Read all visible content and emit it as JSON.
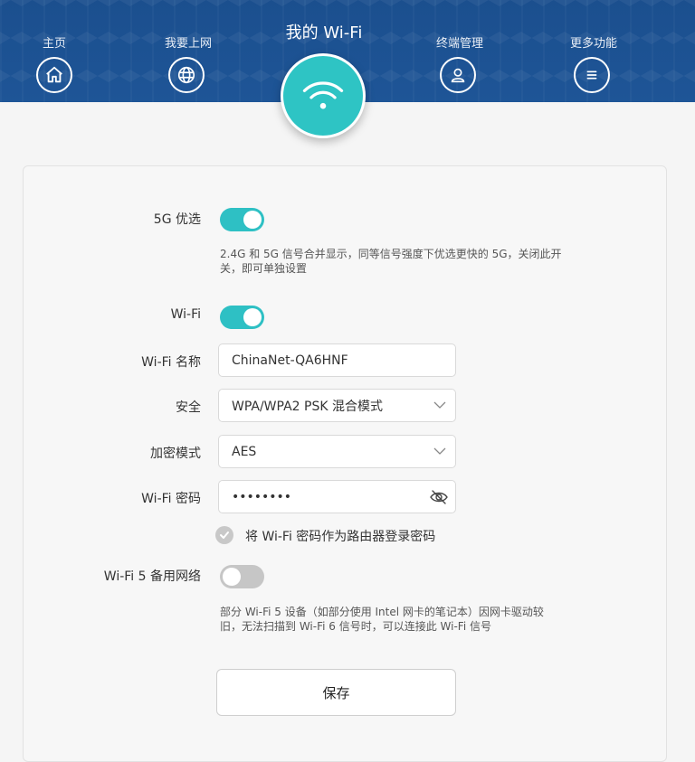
{
  "nav": {
    "items": [
      {
        "label": "主页",
        "icon": "home-icon"
      },
      {
        "label": "我要上网",
        "icon": "globe-icon"
      },
      {
        "label": "终端管理",
        "icon": "user-icon"
      },
      {
        "label": "更多功能",
        "icon": "menu-icon"
      }
    ],
    "active": {
      "label": "我的 Wi-Fi",
      "icon": "wifi-icon"
    }
  },
  "colors": {
    "header": "#1e5597",
    "accent": "#2ec0c4",
    "toggle_off": "#c6c6c6"
  },
  "settings": {
    "band_pref": {
      "label": "5G 优选",
      "state": "on",
      "hint": "2.4G 和 5G 信号合并显示，同等信号强度下优选更快的 5G，关闭此开关，即可单独设置"
    },
    "wifi": {
      "label": "Wi-Fi",
      "state": "on"
    },
    "ssid": {
      "label": "Wi-Fi 名称",
      "value": "ChinaNet-QA6HNF"
    },
    "security": {
      "label": "安全",
      "value": "WPA/WPA2 PSK 混合模式"
    },
    "encryption": {
      "label": "加密模式",
      "value": "AES"
    },
    "password": {
      "label": "Wi-Fi 密码",
      "value": "••••••••"
    },
    "use_as_admin": {
      "label": "将 Wi-Fi 密码作为路由器登录密码",
      "checked": true
    },
    "wifi5_backup": {
      "label": "Wi-Fi 5 备用网络",
      "state": "off",
      "hint": "部分 Wi-Fi 5 设备（如部分使用 Intel 网卡的笔记本）因网卡驱动较旧，无法扫描到 Wi-Fi 6 信号时，可以连接此 Wi-Fi 信号"
    },
    "save_label": "保存"
  }
}
